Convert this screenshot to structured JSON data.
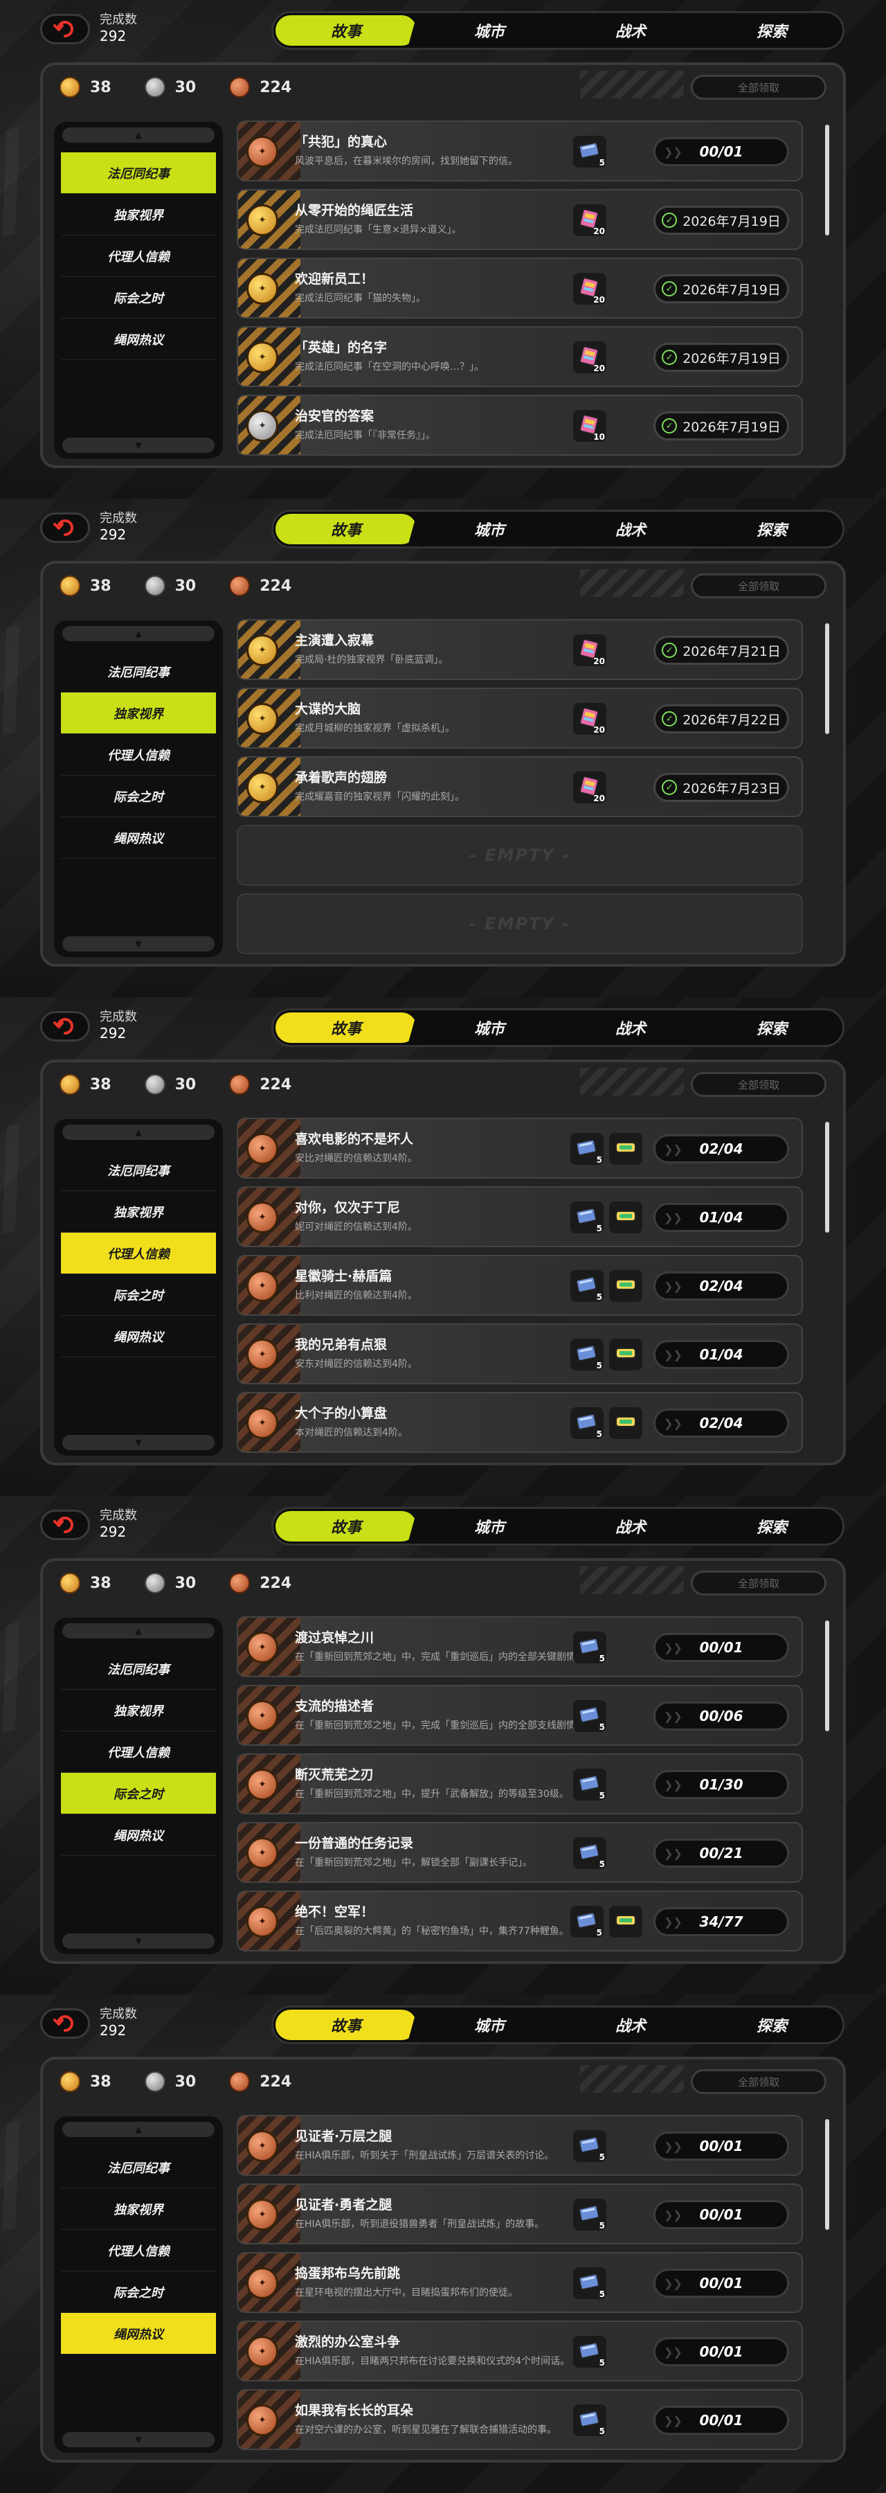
{
  "common": {
    "done_label": "完成数",
    "done_value": "292",
    "tabs": [
      "故事",
      "城市",
      "战术",
      "探索"
    ],
    "currency": [
      {
        "type": "gold",
        "value": "38"
      },
      {
        "type": "silver",
        "value": "30"
      },
      {
        "type": "bronze",
        "value": "224"
      }
    ],
    "claim_all": "全部领取",
    "categories": [
      "法厄同纪事",
      "独家视界",
      "代理人信赖",
      "际会之时",
      "绳网热议"
    ],
    "accent_green": "#c8e015",
    "accent_yellow": "#f2df1c"
  },
  "frames": [
    {
      "active_category": 0,
      "accent": "green",
      "rows": [
        {
          "title": "「共犯」的真心",
          "desc": "风波平息后，在暮米埃尔的房间，找到她留下的信。",
          "medal": "bronze",
          "reward_icon": "ticket-icon",
          "reward_count": "5",
          "progress": "00/01",
          "status": "ongoing"
        },
        {
          "title": "从零开始的绳匠生活",
          "desc": "完成法厄同纪事「生意×退异×道义」。",
          "medal": "gold",
          "reward_icon": "card-icon",
          "reward_count": "20",
          "date": "2026年7月19日",
          "status": "done"
        },
        {
          "title": "欢迎新员工！",
          "desc": "完成法厄同纪事「猫的失物」。",
          "medal": "gold",
          "reward_icon": "card-icon",
          "reward_count": "20",
          "date": "2026年7月19日",
          "status": "done"
        },
        {
          "title": "「英雄」的名字",
          "desc": "完成法厄同纪事「在空洞的中心呼唤…？」。",
          "medal": "gold",
          "reward_icon": "card-icon",
          "reward_count": "20",
          "date": "2026年7月19日",
          "status": "done"
        },
        {
          "title": "治安官的答案",
          "desc": "完成法厄同纪事「『非常任务』」。",
          "medal": "silver",
          "reward_icon": "card-icon",
          "reward_count": "10",
          "date": "2026年7月19日",
          "status": "done"
        }
      ]
    },
    {
      "active_category": 1,
      "accent": "green",
      "rows": [
        {
          "title": "主演遭入寂幕",
          "desc": "完成局·杜的独家视界「卧底蓝调」。",
          "medal": "gold",
          "reward_icon": "card-icon",
          "reward_count": "20",
          "date": "2026年7月21日",
          "status": "done"
        },
        {
          "title": "大谍的大脑",
          "desc": "完成月城柳的独家视界「虚拟杀机」。",
          "medal": "gold",
          "reward_icon": "card-icon",
          "reward_count": "20",
          "date": "2026年7月22日",
          "status": "done"
        },
        {
          "title": "承着歌声的翅膀",
          "desc": "完成耀嘉音的独家视界「闪耀的此刻」。",
          "medal": "gold",
          "reward_icon": "card-icon",
          "reward_count": "20",
          "date": "2026年7月23日",
          "status": "done"
        },
        {
          "empty": "- EMPTY -"
        },
        {
          "empty": "- EMPTY -"
        }
      ]
    },
    {
      "active_category": 2,
      "accent": "yellow",
      "rows": [
        {
          "title": "喜欢电影的不是坏人",
          "desc": "安比对绳匠的信赖达到4阶。",
          "medal": "bronze",
          "reward_icon": "ticket-icon",
          "reward_count": "5",
          "reward2": true,
          "progress": "02/04",
          "status": "ongoing"
        },
        {
          "title": "对你，仅次于丁尼",
          "desc": "妮可对绳匠的信赖达到4阶。",
          "medal": "bronze",
          "reward_icon": "ticket-icon",
          "reward_count": "5",
          "reward2": true,
          "progress": "01/04",
          "status": "ongoing"
        },
        {
          "title": "星徽骑士·赫盾篇",
          "desc": "比利对绳匠的信赖达到4阶。",
          "medal": "bronze",
          "reward_icon": "ticket-icon",
          "reward_count": "5",
          "reward2": true,
          "progress": "02/04",
          "status": "ongoing"
        },
        {
          "title": "我的兄弟有点狠",
          "desc": "安东对绳匠的信赖达到4阶。",
          "medal": "bronze",
          "reward_icon": "ticket-icon",
          "reward_count": "5",
          "reward2": true,
          "progress": "01/04",
          "status": "ongoing"
        },
        {
          "title": "大个子的小算盘",
          "desc": "本对绳匠的信赖达到4阶。",
          "medal": "bronze",
          "reward_icon": "ticket-icon",
          "reward_count": "5",
          "reward2": true,
          "progress": "02/04",
          "status": "ongoing"
        }
      ]
    },
    {
      "active_category": 3,
      "accent": "green",
      "rows": [
        {
          "title": "渡过哀悼之川",
          "desc": "在「重新回到荒郊之地」中，完成「重剑巡后」内的全部关键剧情。",
          "medal": "bronze",
          "reward_icon": "ticket-icon",
          "reward_count": "5",
          "progress": "00/01",
          "status": "ongoing"
        },
        {
          "title": "支流的描述者",
          "desc": "在「重新回到荒郊之地」中，完成「重剑巡后」内的全部支线剧情。",
          "medal": "bronze",
          "reward_icon": "ticket-icon",
          "reward_count": "5",
          "progress": "00/06",
          "status": "ongoing"
        },
        {
          "title": "断灭荒芜之刃",
          "desc": "在「重新回到荒郊之地」中，提升「武备解放」的等级至30级。",
          "medal": "bronze",
          "reward_icon": "ticket-icon",
          "reward_count": "5",
          "progress": "01/30",
          "status": "ongoing"
        },
        {
          "title": "一份普通的任务记录",
          "desc": "在「重新回到荒郊之地」中，解锁全部「副课长手记」。",
          "medal": "bronze",
          "reward_icon": "ticket-icon",
          "reward_count": "5",
          "progress": "00/21",
          "status": "ongoing"
        },
        {
          "title": "绝不！空军！",
          "desc": "在「后匹奥裂的大鳄黄」的「秘密钓鱼场」中，集齐77种鲤鱼。",
          "medal": "bronze",
          "reward_icon": "ticket-icon",
          "reward_count": "5",
          "reward2": true,
          "progress": "34/77",
          "status": "ongoing"
        }
      ]
    },
    {
      "active_category": 4,
      "accent": "yellow",
      "rows": [
        {
          "title": "见证者·万层之腿",
          "desc": "在HIA俱乐部，听到关于「刑皇战试炼」万层谱关表的讨论。",
          "medal": "bronze",
          "reward_icon": "ticket-icon",
          "reward_count": "5",
          "progress": "00/01",
          "status": "ongoing"
        },
        {
          "title": "见证者·勇者之腿",
          "desc": "在HIA俱乐部，听到退役猎兽勇者「刑皇战试炼」的故事。",
          "medal": "bronze",
          "reward_icon": "ticket-icon",
          "reward_count": "5",
          "progress": "00/01",
          "status": "ongoing"
        },
        {
          "title": "捣蛋邦布乌先前跳",
          "desc": "在星环电视的摆出大厅中，目睹捣蛋邦布们的使徒。",
          "medal": "bronze",
          "reward_icon": "ticket-icon",
          "reward_count": "5",
          "progress": "00/01",
          "status": "ongoing"
        },
        {
          "title": "激烈的办公室斗争",
          "desc": "在HIA俱乐部，目睹两只邦布在讨论要兑换和仪式的4个时间话。",
          "medal": "bronze",
          "reward_icon": "ticket-icon",
          "reward_count": "5",
          "progress": "00/01",
          "status": "ongoing"
        },
        {
          "title": "如果我有长长的耳朵",
          "desc": "在对空六课的办公室，听到星见雅在了解联合捕猎活动的事。",
          "medal": "bronze",
          "reward_icon": "ticket-icon",
          "reward_count": "5",
          "progress": "00/01",
          "status": "ongoing"
        }
      ]
    }
  ]
}
